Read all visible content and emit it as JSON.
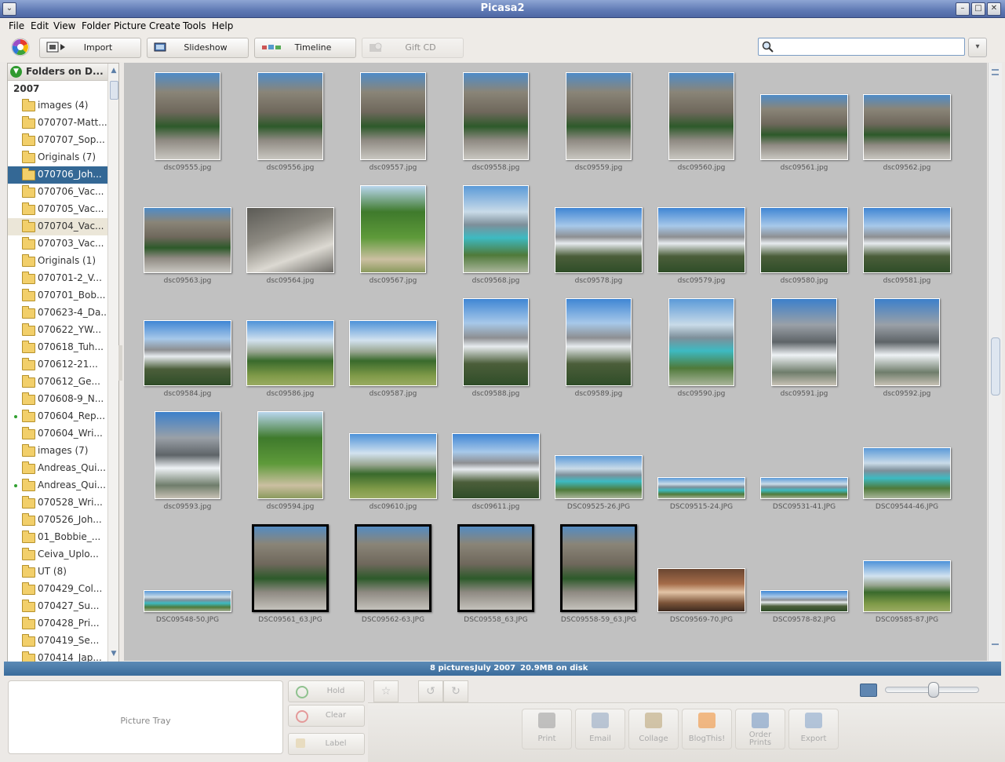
{
  "window": {
    "title": "Picasa2"
  },
  "menu": [
    "File",
    "Edit",
    "View",
    "Folder",
    "Picture",
    "Create",
    "Tools",
    "Help"
  ],
  "toolbar": {
    "import": "Import",
    "slideshow": "Slideshow",
    "timeline": "Timeline",
    "giftcd": "Gift CD"
  },
  "search": {
    "value": ""
  },
  "sidebar": {
    "header": "Folders on D...",
    "year": "2007",
    "items": [
      {
        "label": "images (4)",
        "dot": false,
        "selected": false,
        "hover": false
      },
      {
        "label": "070707-Matt...",
        "dot": false,
        "selected": false,
        "hover": false
      },
      {
        "label": "070707_Sop...",
        "dot": false,
        "selected": false,
        "hover": false
      },
      {
        "label": "Originals (7)",
        "dot": false,
        "selected": false,
        "hover": false
      },
      {
        "label": "070706_Joh...",
        "dot": false,
        "selected": true,
        "hover": false
      },
      {
        "label": "070706_Vac...",
        "dot": false,
        "selected": false,
        "hover": false
      },
      {
        "label": "070705_Vac...",
        "dot": false,
        "selected": false,
        "hover": false
      },
      {
        "label": "070704_Vac...",
        "dot": false,
        "selected": false,
        "hover": true
      },
      {
        "label": "070703_Vac...",
        "dot": false,
        "selected": false,
        "hover": false
      },
      {
        "label": "Originals (1)",
        "dot": false,
        "selected": false,
        "hover": false
      },
      {
        "label": "070701-2_V...",
        "dot": false,
        "selected": false,
        "hover": false
      },
      {
        "label": "070701_Bob...",
        "dot": false,
        "selected": false,
        "hover": false
      },
      {
        "label": "070623-4_Da...",
        "dot": false,
        "selected": false,
        "hover": false
      },
      {
        "label": "070622_YW...",
        "dot": false,
        "selected": false,
        "hover": false
      },
      {
        "label": "070618_Tuh...",
        "dot": false,
        "selected": false,
        "hover": false
      },
      {
        "label": "070612-21...",
        "dot": false,
        "selected": false,
        "hover": false
      },
      {
        "label": "070612_Ge...",
        "dot": false,
        "selected": false,
        "hover": false
      },
      {
        "label": "070608-9_N...",
        "dot": false,
        "selected": false,
        "hover": false
      },
      {
        "label": "070604_Rep...",
        "dot": true,
        "selected": false,
        "hover": false
      },
      {
        "label": "070604_Wri...",
        "dot": false,
        "selected": false,
        "hover": false
      },
      {
        "label": "images (7)",
        "dot": false,
        "selected": false,
        "hover": false
      },
      {
        "label": "Andreas_Qui...",
        "dot": false,
        "selected": false,
        "hover": false
      },
      {
        "label": "Andreas_Qui...",
        "dot": true,
        "selected": false,
        "hover": false
      },
      {
        "label": "070528_Wri...",
        "dot": false,
        "selected": false,
        "hover": false
      },
      {
        "label": "070526_Joh...",
        "dot": false,
        "selected": false,
        "hover": false
      },
      {
        "label": "01_Bobbie_...",
        "dot": false,
        "selected": false,
        "hover": false
      },
      {
        "label": "Ceiva_Uplo...",
        "dot": false,
        "selected": false,
        "hover": false
      },
      {
        "label": "UT (8)",
        "dot": false,
        "selected": false,
        "hover": false
      },
      {
        "label": "070429_Col...",
        "dot": false,
        "selected": false,
        "hover": false
      },
      {
        "label": "070427_Su...",
        "dot": false,
        "selected": false,
        "hover": false
      },
      {
        "label": "070428_Pri...",
        "dot": false,
        "selected": false,
        "hover": false
      },
      {
        "label": "070419_Se...",
        "dot": false,
        "selected": false,
        "hover": false
      },
      {
        "label": "070414_Jap...",
        "dot": false,
        "selected": false,
        "hover": false
      }
    ]
  },
  "photos": [
    {
      "name": "dsc09555.jpg",
      "shape": "portrait",
      "style": "cliff"
    },
    {
      "name": "dsc09556.jpg",
      "shape": "portrait",
      "style": "cliff"
    },
    {
      "name": "dsc09557.jpg",
      "shape": "portrait",
      "style": "cliff"
    },
    {
      "name": "dsc09558.jpg",
      "shape": "portrait",
      "style": "cliff"
    },
    {
      "name": "dsc09559.jpg",
      "shape": "portrait",
      "style": "cliff"
    },
    {
      "name": "dsc09560.jpg",
      "shape": "portrait",
      "style": "cliff"
    },
    {
      "name": "dsc09561.jpg",
      "shape": "landscape",
      "style": "cliff"
    },
    {
      "name": "dsc09562.jpg",
      "shape": "landscape",
      "style": "cliff"
    },
    {
      "name": "dsc09563.jpg",
      "shape": "landscape",
      "style": "cliff"
    },
    {
      "name": "dsc09564.jpg",
      "shape": "landscape",
      "style": "rocks"
    },
    {
      "name": "dsc09567.jpg",
      "shape": "portrait",
      "style": "forest"
    },
    {
      "name": "dsc09568.jpg",
      "shape": "portrait",
      "style": "lake"
    },
    {
      "name": "dsc09578.jpg",
      "shape": "landscape",
      "style": "mountain"
    },
    {
      "name": "dsc09579.jpg",
      "shape": "landscape",
      "style": "mountain"
    },
    {
      "name": "dsc09580.jpg",
      "shape": "landscape",
      "style": "mountain"
    },
    {
      "name": "dsc09581.jpg",
      "shape": "landscape",
      "style": "mountain"
    },
    {
      "name": "dsc09584.jpg",
      "shape": "landscape",
      "style": "mountain"
    },
    {
      "name": "dsc09586.jpg",
      "shape": "landscape",
      "style": "meadow"
    },
    {
      "name": "dsc09587.jpg",
      "shape": "landscape",
      "style": "meadow"
    },
    {
      "name": "dsc09588.jpg",
      "shape": "portrait",
      "style": "mountain"
    },
    {
      "name": "dsc09589.jpg",
      "shape": "portrait",
      "style": "mountain"
    },
    {
      "name": "dsc09590.jpg",
      "shape": "portrait",
      "style": "lake"
    },
    {
      "name": "dsc09591.jpg",
      "shape": "portrait",
      "style": "glacier"
    },
    {
      "name": "dsc09592.jpg",
      "shape": "portrait",
      "style": "glacier"
    },
    {
      "name": "dsc09593.jpg",
      "shape": "portrait",
      "style": "glacier"
    },
    {
      "name": "dsc09594.jpg",
      "shape": "portrait",
      "style": "forest"
    },
    {
      "name": "dsc09610.jpg",
      "shape": "landscape",
      "style": "meadow"
    },
    {
      "name": "dsc09611.jpg",
      "shape": "landscape",
      "style": "mountain"
    },
    {
      "name": "DSC09525-26.JPG",
      "shape": "wide",
      "style": "lake"
    },
    {
      "name": "DSC09515-24.JPG",
      "shape": "pano",
      "style": "lake"
    },
    {
      "name": "DSC09531-41.JPG",
      "shape": "pano",
      "style": "lake"
    },
    {
      "name": "DSC09544-46.JPG",
      "shape": "wide2",
      "style": "lake"
    },
    {
      "name": "DSC09548-50.JPG",
      "shape": "pano",
      "style": "lake"
    },
    {
      "name": "DSC09561_63.JPG",
      "shape": "tall",
      "style": "cliff"
    },
    {
      "name": "DSC09562-63.JPG",
      "shape": "tall",
      "style": "cliff"
    },
    {
      "name": "DSC09558_63.JPG",
      "shape": "tall",
      "style": "cliff"
    },
    {
      "name": "DSC09558-59_63.JPG",
      "shape": "tall",
      "style": "cliff"
    },
    {
      "name": "DSC09569-70.JPG",
      "shape": "wide",
      "style": "indoor"
    },
    {
      "name": "DSC09578-82.JPG",
      "shape": "pano",
      "style": "mountain"
    },
    {
      "name": "DSC09585-87.JPG",
      "shape": "wide2",
      "style": "meadow"
    },
    {
      "name": "",
      "shape": "wide",
      "style": "lake"
    }
  ],
  "status": {
    "count": "8 pictures",
    "date": "July 2007",
    "size": "20.9MB on disk"
  },
  "tray": {
    "title": "Picture Tray",
    "hold": "Hold",
    "clear": "Clear",
    "label": "Label"
  },
  "actions": [
    {
      "label": "Print",
      "icon": "printer-icon",
      "color": "#999999"
    },
    {
      "label": "Email",
      "icon": "email-icon",
      "color": "#8ca3c0"
    },
    {
      "label": "Collage",
      "icon": "collage-icon",
      "color": "#b8a070"
    },
    {
      "label": "BlogThis!",
      "icon": "blogger-icon",
      "color": "#f08a2c"
    },
    {
      "label": "Order Prints",
      "icon": "order-prints-icon",
      "color": "#6a8fc0"
    },
    {
      "label": "Export",
      "icon": "export-icon",
      "color": "#7fa0c8"
    }
  ],
  "zoom": {
    "level": 0.52
  }
}
